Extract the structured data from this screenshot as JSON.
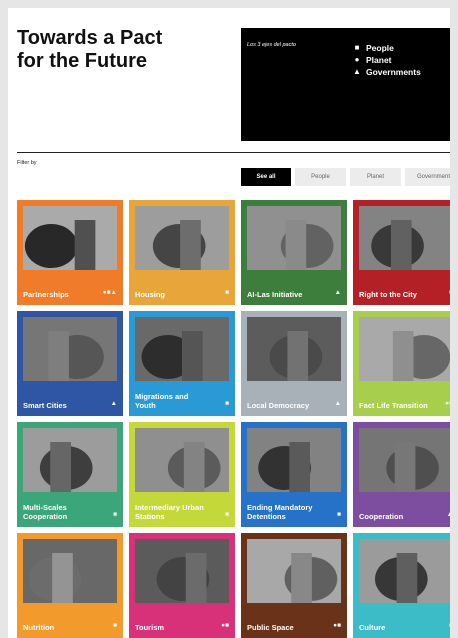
{
  "header": {
    "title_line1": "Towards a Pact",
    "title_line2": "for the Future"
  },
  "legend": {
    "subtitle": "Los 3 ejes del pacto",
    "items": [
      {
        "icon": "square-icon",
        "glyph": "■",
        "label": "People"
      },
      {
        "icon": "circle-icon",
        "glyph": "●",
        "label": "Planet"
      },
      {
        "icon": "triangle-icon",
        "glyph": "▲",
        "label": "Governments"
      }
    ]
  },
  "filter": {
    "label": "Filter by",
    "options": [
      "See all",
      "People",
      "Planet",
      "Governments"
    ]
  },
  "tiles": [
    {
      "label": "Partnerships",
      "color": "#f07c2a",
      "markers": "●■▲",
      "name": "tile-partnerships"
    },
    {
      "label": "Housing",
      "color": "#e8a63a",
      "markers": "■",
      "name": "tile-housing"
    },
    {
      "label": "AI-Las Initiative",
      "color": "#3e7e3c",
      "markers": "▲",
      "name": "tile-ai-las-initiative"
    },
    {
      "label": "Right to the City",
      "color": "#b32025",
      "markers": "■",
      "name": "tile-right-to-the-city"
    },
    {
      "label": "Smart Cities",
      "color": "#2f56a4",
      "markers": "▲",
      "name": "tile-smart-cities"
    },
    {
      "label": "Migrations and Youth",
      "color": "#2a9ad6",
      "markers": "■",
      "name": "tile-migrations-and-youth"
    },
    {
      "label": "Local Democracy",
      "color": "#a8b0b8",
      "markers": "▲",
      "name": "tile-local-democracy"
    },
    {
      "label": "Fact Life Transition",
      "color": "#a7cf4b",
      "markers": "●■",
      "name": "tile-fact-life-transition"
    },
    {
      "label": "Multi-Scales Cooperation",
      "color": "#3aa67a",
      "markers": "■",
      "name": "tile-multi-scales-cooperation"
    },
    {
      "label": "Intermediary Urban Stations",
      "color": "#c4d83a",
      "markers": "■",
      "name": "tile-intermediary-urban-stations"
    },
    {
      "label": "Ending Mandatory Detentions",
      "color": "#2672c8",
      "markers": "■",
      "name": "tile-ending-mandatory-detentions"
    },
    {
      "label": "Cooperation",
      "color": "#7d4ea0",
      "markers": "▲",
      "name": "tile-cooperation"
    },
    {
      "label": "Nutrition",
      "color": "#f29a2c",
      "markers": "■",
      "name": "tile-nutrition"
    },
    {
      "label": "Tourism",
      "color": "#d8317a",
      "markers": "●■",
      "name": "tile-tourism"
    },
    {
      "label": "Public Space",
      "color": "#6a3218",
      "markers": "●■",
      "name": "tile-public-space"
    },
    {
      "label": "Culture",
      "color": "#3cbcc6",
      "markers": "■",
      "name": "tile-culture"
    }
  ]
}
